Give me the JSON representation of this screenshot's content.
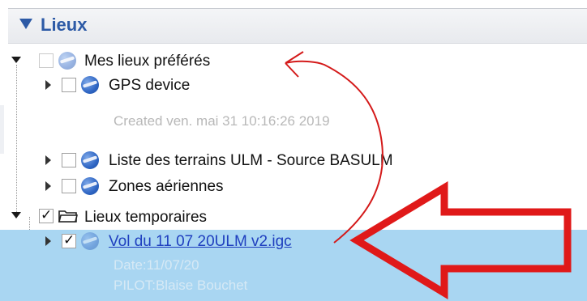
{
  "header": {
    "title": "Lieux"
  },
  "tree": {
    "my_places": {
      "label": "Mes lieux préférés",
      "checked": false
    },
    "gps_device": {
      "label": "GPS device",
      "checked": false,
      "created": "Created ven. mai 31 10:16:26 2019"
    },
    "ulm_fields": {
      "label": "Liste des terrains ULM - Source BASULM",
      "checked": false
    },
    "air_zones": {
      "label": "Zones aériennes",
      "checked": false
    },
    "temp_places": {
      "label": "Lieux temporaires",
      "checked": true
    },
    "flight": {
      "label": "Vol du 11 07 20ULM v2.igc",
      "checked": true,
      "date": "Date:11/07/20",
      "pilot": "PILOT:Blaise Bouchet"
    }
  },
  "colors": {
    "header_text": "#2d5aa6",
    "selection": "#a9d6f2",
    "annotation": "#e01919",
    "link": "#1f3fbf"
  },
  "icons": [
    "expand-down-icon",
    "expand-right-icon",
    "globe-icon",
    "folder-icon",
    "checkbox-icon"
  ]
}
